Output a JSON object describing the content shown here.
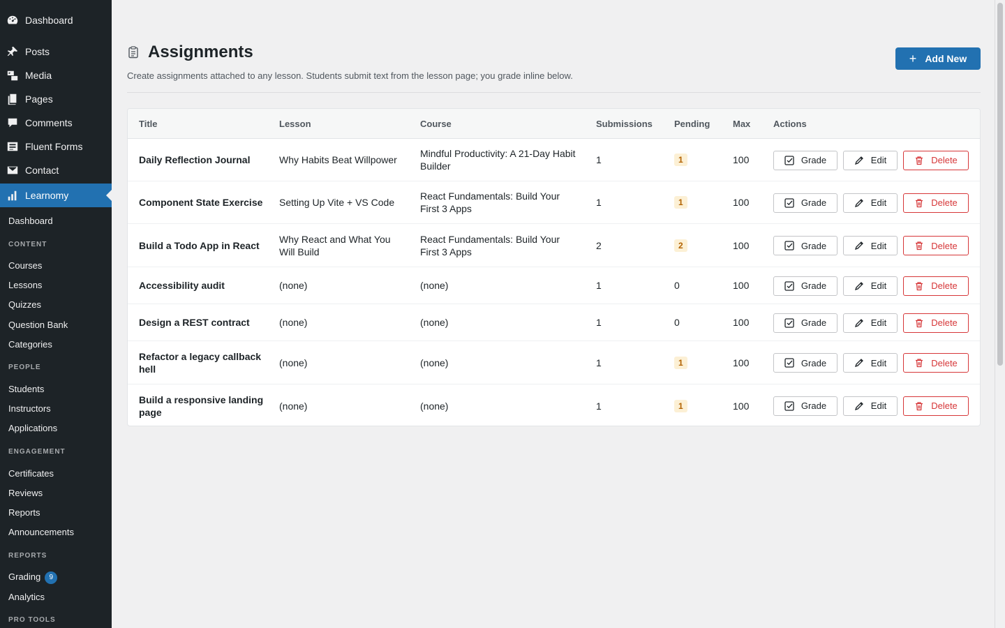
{
  "sidebar": {
    "top_items": [
      {
        "label": "Dashboard",
        "icon": "dashboard-icon"
      },
      {
        "label": "Posts",
        "icon": "pin-icon"
      },
      {
        "label": "Media",
        "icon": "media-icon"
      },
      {
        "label": "Pages",
        "icon": "pages-icon"
      },
      {
        "label": "Comments",
        "icon": "comment-icon"
      },
      {
        "label": "Fluent Forms",
        "icon": "forms-icon"
      },
      {
        "label": "Contact",
        "icon": "mail-icon"
      },
      {
        "label": "Learnomy",
        "icon": "chart-bars-icon",
        "active": true
      }
    ],
    "sub_dashboard": "Dashboard",
    "content_heading": "CONTENT",
    "content_items": [
      "Courses",
      "Lessons",
      "Quizzes",
      "Question Bank",
      "Categories"
    ],
    "people_heading": "PEOPLE",
    "people_items": [
      "Students",
      "Instructors",
      "Applications"
    ],
    "engagement_heading": "ENGAGEMENT",
    "engagement_items": [
      "Certificates",
      "Reviews",
      "Reports",
      "Announcements"
    ],
    "reports_heading": "REPORTS",
    "reports_items": [
      {
        "label": "Grading",
        "badge": "9"
      },
      {
        "label": "Analytics"
      }
    ],
    "protools_heading": "PRO TOOLS"
  },
  "header": {
    "title": "Assignments",
    "icon": "clipboard-icon",
    "description": "Create assignments attached to any lesson. Students submit text from the lesson page; you grade inline below.",
    "add_new_label": "Add New"
  },
  "table": {
    "columns": [
      "Title",
      "Lesson",
      "Course",
      "Submissions",
      "Pending",
      "Max",
      "Actions"
    ],
    "actions": {
      "grade": "Grade",
      "edit": "Edit",
      "delete": "Delete"
    },
    "rows": [
      {
        "title": "Daily Reflection Journal",
        "lesson": "Why Habits Beat Willpower",
        "course": "Mindful Productivity: A 21-Day Habit Builder",
        "submissions": "1",
        "pending": "1",
        "pending_highlight": true,
        "max": "100"
      },
      {
        "title": "Component State Exercise",
        "lesson": "Setting Up Vite + VS Code",
        "course": "React Fundamentals: Build Your First 3 Apps",
        "submissions": "1",
        "pending": "1",
        "pending_highlight": true,
        "max": "100"
      },
      {
        "title": "Build a Todo App in React",
        "lesson": "Why React and What You Will Build",
        "course": "React Fundamentals: Build Your First 3 Apps",
        "submissions": "2",
        "pending": "2",
        "pending_highlight": true,
        "max": "100"
      },
      {
        "title": "Accessibility audit",
        "lesson": "(none)",
        "course": "(none)",
        "submissions": "1",
        "pending": "0",
        "pending_highlight": false,
        "max": "100"
      },
      {
        "title": "Design a REST contract",
        "lesson": "(none)",
        "course": "(none)",
        "submissions": "1",
        "pending": "0",
        "pending_highlight": false,
        "max": "100"
      },
      {
        "title": "Refactor a legacy callback hell",
        "lesson": "(none)",
        "course": "(none)",
        "submissions": "1",
        "pending": "1",
        "pending_highlight": true,
        "max": "100"
      },
      {
        "title": "Build a responsive landing page",
        "lesson": "(none)",
        "course": "(none)",
        "submissions": "1",
        "pending": "1",
        "pending_highlight": true,
        "max": "100"
      }
    ]
  },
  "colors": {
    "accent": "#2271b1",
    "sidebar_bg": "#1d2327",
    "delete_red": "#d63638",
    "pending_bg": "#fcf0d5",
    "pending_text": "#b26200"
  }
}
